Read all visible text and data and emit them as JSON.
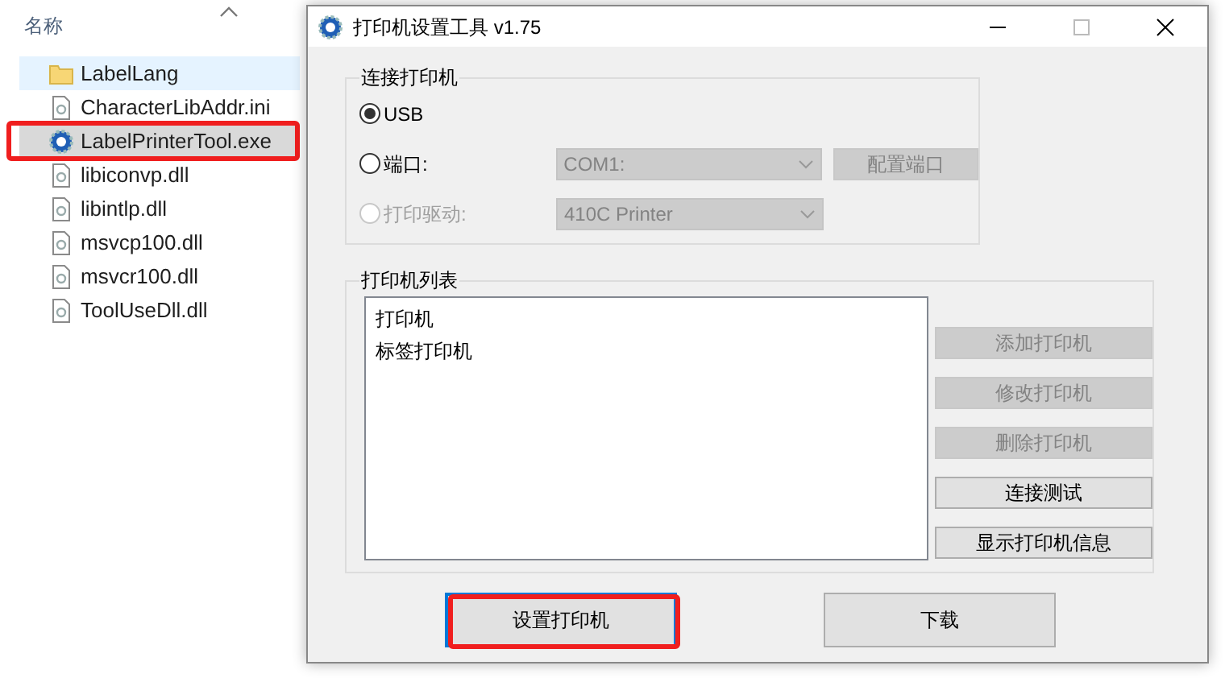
{
  "explorer": {
    "column_header": "名称",
    "files": [
      {
        "name": "LabelLang",
        "kind": "folder",
        "hovered": true,
        "selected": false,
        "highlighted": false
      },
      {
        "name": "CharacterLibAddr.ini",
        "kind": "config",
        "hovered": false,
        "selected": false,
        "highlighted": false
      },
      {
        "name": "LabelPrinterTool.exe",
        "kind": "app",
        "hovered": false,
        "selected": true,
        "highlighted": true
      },
      {
        "name": "libiconvp.dll",
        "kind": "library",
        "hovered": false,
        "selected": false,
        "highlighted": false
      },
      {
        "name": "libintlp.dll",
        "kind": "library",
        "hovered": false,
        "selected": false,
        "highlighted": false
      },
      {
        "name": "msvcp100.dll",
        "kind": "library",
        "hovered": false,
        "selected": false,
        "highlighted": false
      },
      {
        "name": "msvcr100.dll",
        "kind": "library",
        "hovered": false,
        "selected": false,
        "highlighted": false
      },
      {
        "name": "ToolUseDll.dll",
        "kind": "library",
        "hovered": false,
        "selected": false,
        "highlighted": false
      }
    ]
  },
  "dialog": {
    "title": "打印机设置工具 v1.75",
    "connection_group": {
      "title": "连接打印机",
      "options": [
        {
          "label": "USB",
          "selected": true,
          "disabled": false
        },
        {
          "label": "端口:",
          "selected": false,
          "disabled": false,
          "combo": {
            "value": "COM1:",
            "disabled": true
          },
          "button": {
            "label": "配置端口",
            "disabled": true
          }
        },
        {
          "label": "打印驱动:",
          "selected": false,
          "disabled": true,
          "combo": {
            "value": "410C Printer",
            "disabled": true
          }
        }
      ]
    },
    "printer_list": {
      "title": "打印机列表",
      "items": [
        "打印机",
        "标签打印机"
      ],
      "buttons": [
        {
          "label": "添加打印机",
          "disabled": true
        },
        {
          "label": "修改打印机",
          "disabled": true
        },
        {
          "label": "删除打印机",
          "disabled": true
        },
        {
          "label": "连接测试",
          "disabled": false
        },
        {
          "label": "显示打印机信息",
          "disabled": false
        }
      ]
    },
    "bottom_buttons": [
      {
        "label": "设置打印机",
        "focused": true,
        "highlighted": true
      },
      {
        "label": "下载",
        "focused": false,
        "highlighted": false
      }
    ]
  }
}
